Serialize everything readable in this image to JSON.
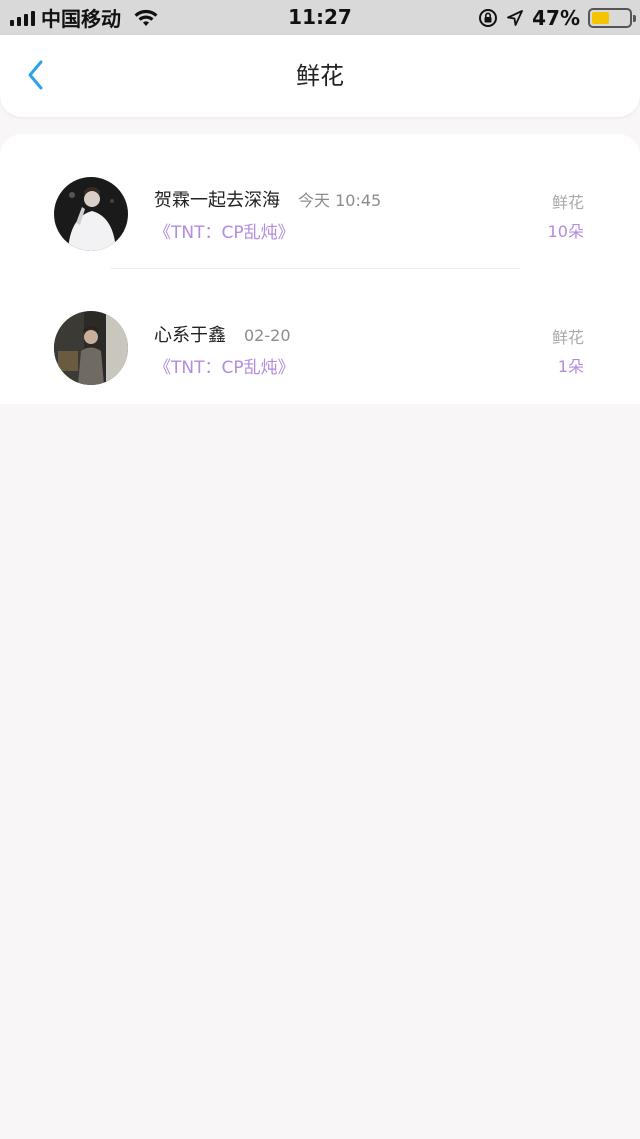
{
  "status_bar": {
    "carrier": "中国移动",
    "time": "11:27",
    "battery_percent": "47%",
    "battery_level": 0.47,
    "signal_icon": "signal-bars-icon",
    "wifi_icon": "wifi-icon",
    "lock_icon": "orientation-lock-icon",
    "location_icon": "location-arrow-icon",
    "battery_color": "#f5c400"
  },
  "nav": {
    "title": "鲜花",
    "back_icon": "chevron-left-icon",
    "accent_color": "#2aa3e8"
  },
  "records": [
    {
      "name": "贺霖一起去深海",
      "time": "今天 10:45",
      "book": "《TNT：CP乱炖》",
      "type": "鲜花",
      "count": "10朵"
    },
    {
      "name": "心系于鑫",
      "time": "02-20",
      "book": "《TNT：CP乱炖》",
      "type": "鲜花",
      "count": "1朵"
    }
  ],
  "colors": {
    "highlight": "#b38be0",
    "background": "#f8f6f7"
  }
}
